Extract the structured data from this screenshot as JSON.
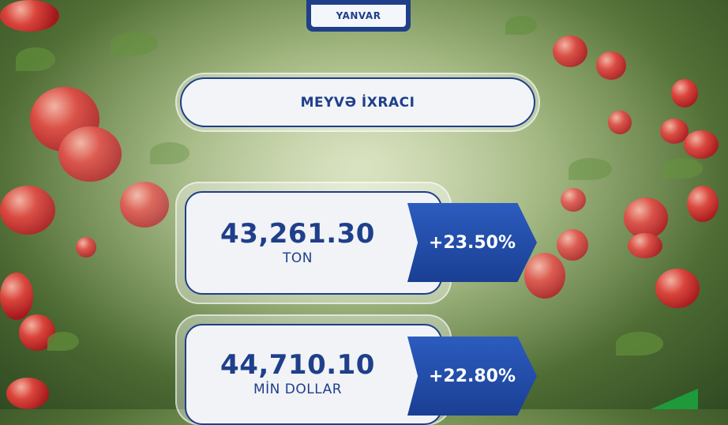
{
  "month": "YANVAR",
  "title": "MEYVƏ İXRACI",
  "cards": [
    {
      "value": "43,261.30",
      "unit": "TON",
      "change": "+23.50%"
    },
    {
      "value": "44,710.10",
      "unit": "MİN DOLLAR",
      "change": "+22.80%"
    }
  ],
  "colors": {
    "brand_blue": "#1f3f8a",
    "accent_green": "#1e9a3a"
  }
}
